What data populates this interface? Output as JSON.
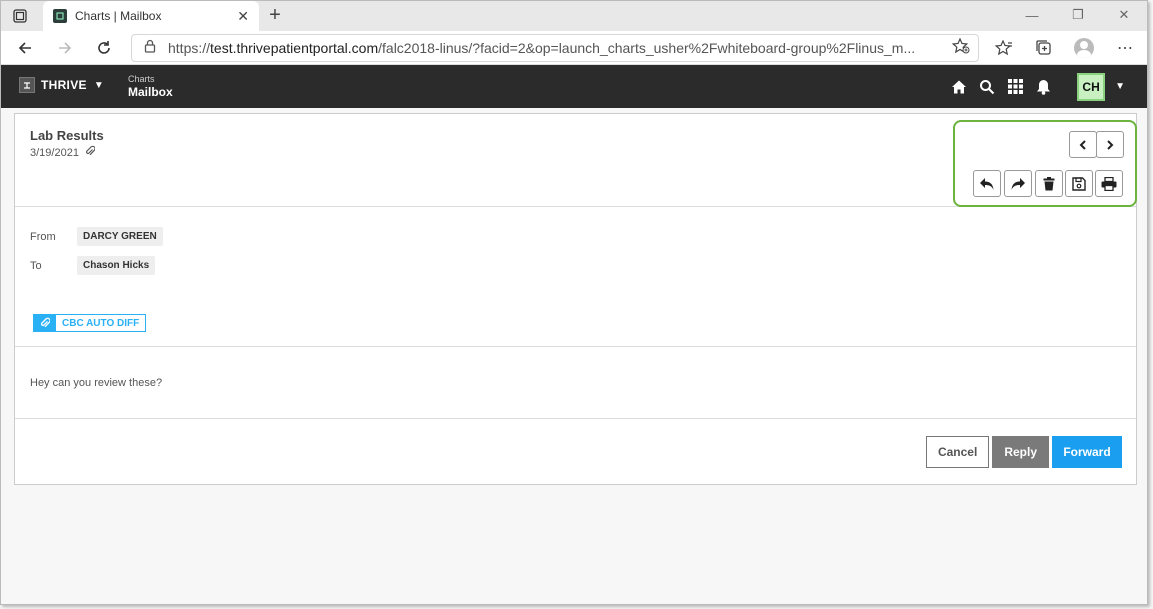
{
  "browser": {
    "tab_title": "Charts | Mailbox",
    "new_tab_symbol": "+",
    "url_scheme": "https://",
    "url_host": "test.thrivepatientportal.com",
    "url_path": "/falc2018-linus/?facid=2&op=launch_charts_usher%2Fwhiteboard-group%2Flinus_m..."
  },
  "app": {
    "brand": "THRIVE",
    "breadcrumb_parent": "Charts",
    "breadcrumb_current": "Mailbox",
    "user_initials": "CH"
  },
  "message": {
    "subject": "Lab Results",
    "date": "3/19/2021",
    "from_label": "From",
    "from_value": "DARCY GREEN",
    "to_label": "To",
    "to_value": "Chason Hicks",
    "attachment_name": "CBC AUTO DIFF",
    "body": "Hey can you review these?"
  },
  "buttons": {
    "cancel": "Cancel",
    "reply": "Reply",
    "forward": "Forward"
  },
  "colors": {
    "toolbar_highlight": "#6cb33f",
    "primary": "#1a9ff0",
    "header_bg": "#2b2b2b"
  }
}
